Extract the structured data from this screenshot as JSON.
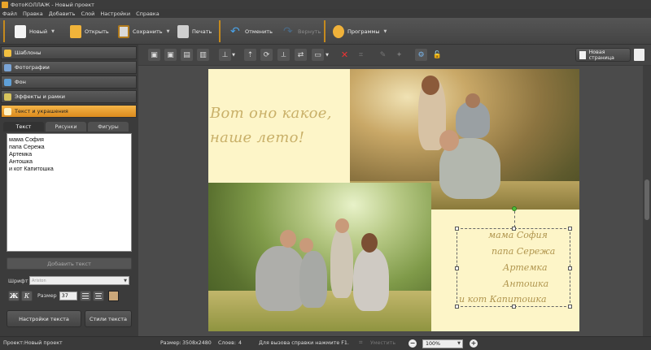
{
  "window": {
    "title": "ФотоКОЛЛАЖ - Новый проект"
  },
  "menu": [
    "Файл",
    "Правка",
    "Добавить",
    "Слой",
    "Настройки",
    "Справка"
  ],
  "toolbar": {
    "new": "Новый",
    "open": "Открыть",
    "save": "Сохранить",
    "print": "Печать",
    "undo": "Отменить",
    "redo": "Вернуть",
    "programs": "Программы"
  },
  "sidebar": {
    "sections": [
      {
        "label": "Шаблоны",
        "icon": "star-icon",
        "active": false
      },
      {
        "label": "Фотографии",
        "icon": "photos-icon",
        "active": false
      },
      {
        "label": "Фон",
        "icon": "background-icon",
        "active": false
      },
      {
        "label": "Эффекты и рамки",
        "icon": "effects-icon",
        "active": false
      },
      {
        "label": "Текст и украшения",
        "icon": "text-decor-icon",
        "active": true
      }
    ],
    "tabs": [
      "Текст",
      "Рисунки",
      "Фигуры"
    ],
    "text_lines": [
      "мама София",
      "папа Сережа",
      "Артемка",
      "Антошка",
      "и кот Капитошка"
    ],
    "add_text": "Добавить текст",
    "font_label": "Шрифт",
    "font_value": "Ariston",
    "bold": "Ж",
    "italic": "К",
    "size_label": "Размер",
    "size_value": "37",
    "text_settings": "Настройки текста",
    "text_styles": "Стили текста"
  },
  "edit_toolbar": {
    "new_page": "Новая страница"
  },
  "canvas": {
    "title_text": [
      "Вот оно какое,",
      "наше лето!"
    ],
    "names": [
      "мама София",
      "папа Сережа",
      "Артемка",
      "Антошка",
      "и кот Капитошка"
    ]
  },
  "status": {
    "project_label": "Проект:",
    "project_value": "Новый проект",
    "size_label": "Размер:",
    "size_value": "3508x2480",
    "layers_label": "Слоев:",
    "layers_value": "4",
    "help": "Для вызова справки нажмите F1.",
    "shrink": "Уместить",
    "zoom": "100%"
  },
  "colors": {
    "accent": "#e39a26",
    "page": "#fdf5c8",
    "script_text": "#c9b069"
  }
}
